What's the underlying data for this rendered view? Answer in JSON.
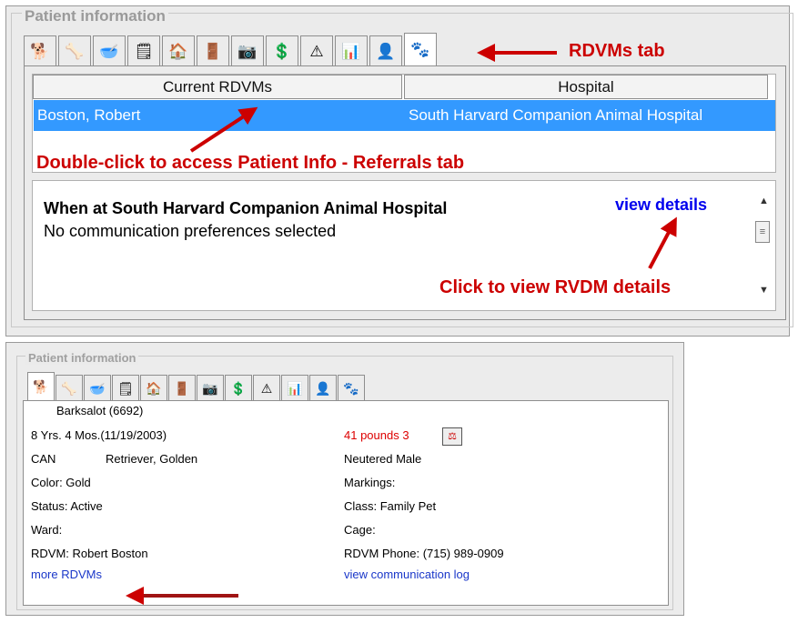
{
  "panel_top": {
    "legend": "Patient information",
    "tabs": [
      {
        "icon": "dog-icon"
      },
      {
        "icon": "dog-treat-icon"
      },
      {
        "icon": "cat-bowl-icon"
      },
      {
        "icon": "document-icon"
      },
      {
        "icon": "house-icon"
      },
      {
        "icon": "door-exit-icon"
      },
      {
        "icon": "camera-icon"
      },
      {
        "icon": "billing-icon"
      },
      {
        "icon": "alert-icon"
      },
      {
        "icon": "chart-icon"
      },
      {
        "icon": "person-icon"
      },
      {
        "icon": "rdvm-icon",
        "selected": true
      }
    ],
    "grid": {
      "columns": [
        "Current RDVMs",
        "Hospital"
      ],
      "rows": [
        {
          "rdvm": "Boston, Robert",
          "hospital": "South Harvard Companion Animal Hospital"
        }
      ]
    },
    "communication": {
      "title": "When at South Harvard Companion Animal Hospital",
      "subtitle": "No communication preferences selected",
      "link": "view details"
    },
    "annotations": {
      "rdvms_tab": "RDVMs tab",
      "double_click": "Double-click to access Patient Info - Referrals tab",
      "click_view": "Click to view RVDM details"
    }
  },
  "panel_bottom": {
    "legend": "Patient information",
    "patient_name": "Barksalot  (6692)",
    "age": "8 Yrs. 4 Mos.(11/19/2003)",
    "weight": "41  pounds  3",
    "species": "CAN",
    "breed": "Retriever, Golden",
    "sex": "Neutered Male",
    "color": "Color:  Gold",
    "markings": "Markings:",
    "status": "Status:  Active",
    "class": "Class:  Family Pet",
    "ward": "Ward:",
    "cage": "Cage:",
    "rdvm": "RDVM:  Robert Boston",
    "rdvm_phone": "RDVM Phone:  (715) 989-0909",
    "more_rdvms": "more RDVMs",
    "view_log": "view communication log"
  },
  "colors": {
    "selection": "#3399ff",
    "annotation_red": "#cc0000",
    "link_blue": "#0000ee"
  }
}
